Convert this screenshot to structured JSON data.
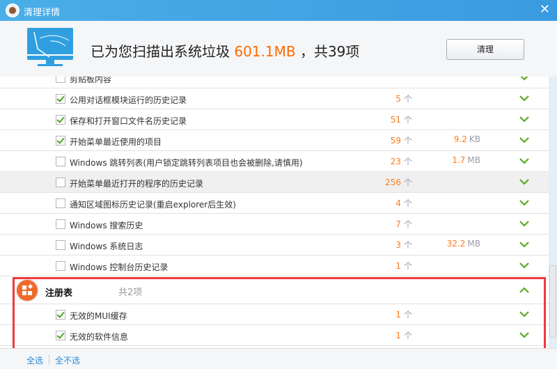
{
  "window": {
    "title": "清理详情",
    "close": "✕"
  },
  "summary": {
    "prefix": "已为您扫描出系统垃圾",
    "size": "601.1MB",
    "suffix": "，共39项",
    "clean_button": "清理"
  },
  "rows": [
    {
      "label": "剪贴板内容",
      "checked": false,
      "count": "",
      "unit": "",
      "size": "",
      "size_unit": ""
    },
    {
      "label": "公用对话框模块运行的历史记录",
      "checked": true,
      "count": "5",
      "unit": "个",
      "size": "",
      "size_unit": ""
    },
    {
      "label": "保存和打开窗口文件名历史记录",
      "checked": true,
      "count": "51",
      "unit": "个",
      "size": "",
      "size_unit": ""
    },
    {
      "label": "开始菜单最近使用的项目",
      "checked": true,
      "count": "59",
      "unit": "个",
      "size": "9.2",
      "size_unit": "KB"
    },
    {
      "label": "Windows 跳转列表(用户锁定跳转列表项目也会被删除,请慎用)",
      "checked": false,
      "count": "23",
      "unit": "个",
      "size": "1.7",
      "size_unit": "MB"
    },
    {
      "label": "开始菜单最近打开的程序的历史记录",
      "checked": false,
      "count": "256",
      "unit": "个",
      "size": "",
      "size_unit": ""
    },
    {
      "label": "通知区域图标历史记录(重启explorer后生效)",
      "checked": false,
      "count": "4",
      "unit": "个",
      "size": "",
      "size_unit": ""
    },
    {
      "label": "Windows 搜索历史",
      "checked": false,
      "count": "7",
      "unit": "个",
      "size": "",
      "size_unit": ""
    },
    {
      "label": "Windows 系统日志",
      "checked": false,
      "count": "3",
      "unit": "个",
      "size": "32.2",
      "size_unit": "MB"
    },
    {
      "label": "Windows 控制台历史记录",
      "checked": false,
      "count": "1",
      "unit": "个",
      "size": "",
      "size_unit": ""
    }
  ],
  "group": {
    "name": "注册表",
    "count": "共2项"
  },
  "group_rows": [
    {
      "label": "无效的MUI缓存",
      "checked": true,
      "count": "1",
      "unit": "个"
    },
    {
      "label": "无效的软件信息",
      "checked": true,
      "count": "1",
      "unit": "个"
    }
  ],
  "footer": {
    "select_all": "全选",
    "select_none": "全不选"
  }
}
